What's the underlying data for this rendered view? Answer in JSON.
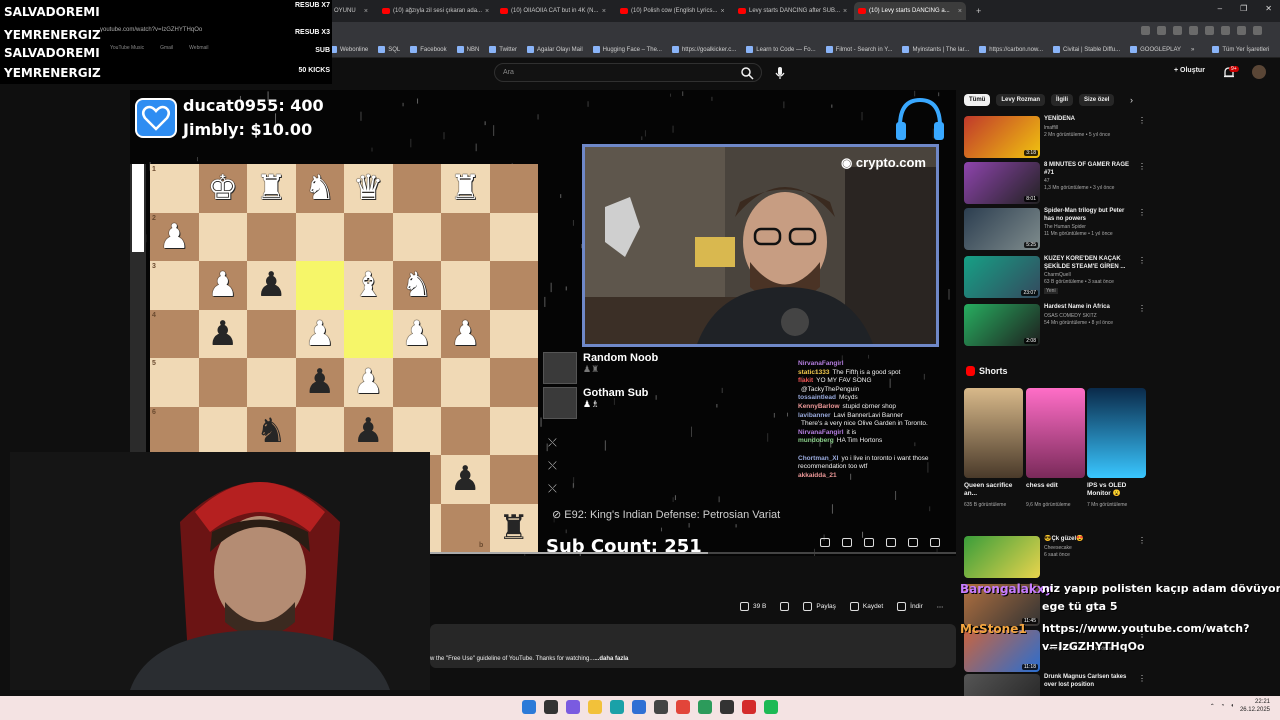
{
  "overlay": {
    "names": [
      "SALVADOREMI",
      "YEMRENERGIZ",
      "SALVADOREMI",
      "YEMRENERGIZ"
    ],
    "badges": [
      "RESUB X7",
      "RESUB X3",
      "SUB",
      "50 KICKS"
    ],
    "ghost_url": "youtube.com/watch?v=IzGZHYTHqOo",
    "ghost_items": [
      "YouTube Music",
      "Gmail",
      "Webmail"
    ]
  },
  "browser": {
    "tabs": [
      {
        "label": "OYUNU",
        "active": false
      },
      {
        "label": "(10) ağzıyla zil sesi çıkaran ada...",
        "active": false
      },
      {
        "label": "(10) OIIAOIIA CAT but in 4K (N...",
        "active": false
      },
      {
        "label": "(10) Polish cow (English Lyrics...",
        "active": false
      },
      {
        "label": "Levy starts DANCING after SUB...",
        "active": false
      },
      {
        "label": "(10) Levy starts DANCING a...",
        "active": true
      }
    ],
    "new_tab": "+",
    "bookmarks": [
      "Webonline",
      "SQL",
      "Facebook",
      "NBN",
      "Twitter",
      "Agalar Olayı Mail",
      "Hugging Face – The...",
      "https://goalkicker.c...",
      "Learn to Code — Fo...",
      "Filmot - Search in Y...",
      "Myinstants | The lar...",
      "https://carbon.now...",
      "Civitai | Stable Diffu...",
      "GOOGLEPLAY"
    ],
    "bookmarks_more": "»",
    "all_bookmarks": "Tüm Yer İşaretleri",
    "window_controls": [
      "–",
      "❐",
      "✕"
    ]
  },
  "youtube": {
    "search_placeholder": "Ara",
    "create_label": "Oluştur",
    "notifications": "9+"
  },
  "video": {
    "donations": [
      {
        "name": "ducat0955",
        "amount": "400"
      },
      {
        "name": "Jimbly",
        "amount": "$10.00"
      }
    ],
    "sponsor": "crypto.com",
    "players": [
      {
        "name": "Random Noob"
      },
      {
        "name": "Gotham Sub"
      }
    ],
    "opening": "E92: King's Indian Defense: Petrosian Variat",
    "sub_count_label": "Sub Count:",
    "sub_count": "251",
    "board_ranks": [
      "1",
      "2",
      "3",
      "4",
      "5",
      "6"
    ],
    "board_files": [
      "b"
    ],
    "chat": [
      {
        "user": "NirvanaFangirl",
        "msg": "",
        "color": "#b57ee0"
      },
      {
        "user": "static1333",
        "msg": "The Fifth is a good spot",
        "color": "#f2c94c"
      },
      {
        "user": "flakit",
        "msg": "YO MY FAV SONG",
        "color": "#e55"
      },
      {
        "user": "",
        "msg": "@TackyThePenguin",
        "color": "#e55"
      },
      {
        "user": "tossaintlead",
        "msg": "Mcyds",
        "color": "#9ad"
      },
      {
        "user": "KennyBarlow",
        "msg": "stupid corner shop",
        "color": "#e99"
      },
      {
        "user": "lavibanner",
        "msg": "Lavi BannerLavi Banner",
        "color": "#9ad"
      },
      {
        "user": "",
        "msg": "There's a very nice Olive Garden in Toronto.",
        "color": "#e55"
      },
      {
        "user": "NirvanaFangirl",
        "msg": "it is",
        "color": "#b57ee0"
      },
      {
        "user": "mundoberg",
        "msg": "HA Tim Hortons",
        "color": "#8c8"
      },
      {
        "user": "",
        "msg": "",
        "color": "#9ad"
      },
      {
        "user": "Chortman_XI",
        "msg": "yo i live in toronto i want those recommendation too wtf",
        "color": "#9ad"
      },
      {
        "user": "akkaidda_21",
        "msg": "",
        "color": "#e99"
      }
    ]
  },
  "actions": {
    "likes": "39 B",
    "share": "Paylaş",
    "save": "Kaydet",
    "download": "İndir",
    "more": "⋯"
  },
  "description": {
    "text": "w the \"Free Use\" guideline of YouTube. Thanks for watching...",
    "more": "...daha fazla"
  },
  "sidebar": {
    "chips": [
      "Tümü",
      "Levy Rozman",
      "İlgili",
      "Size özel"
    ],
    "recommendations": [
      {
        "title": "YENİDENA",
        "channel": "lmaffill",
        "meta": "2 Mn görüntüleme • 5 yıl önce",
        "duration": "3:18"
      },
      {
        "title": "8 MINUTES OF GAMER RAGE #71",
        "channel": "47",
        "meta": "1,3 Mn görüntüleme • 3 yıl önce",
        "duration": "8:01"
      },
      {
        "title": "Spider-Man trilogy but Peter has no powers",
        "channel": "The Human Spider",
        "meta": "11 Mn görüntüleme • 1 yıl önce",
        "duration": "5:25"
      },
      {
        "title": "KUZEY KORE'DEN KAÇAK ŞEKİLDE STEAM'E GİREN ...",
        "channel": "CharmQuell",
        "meta": "63 B görüntüleme • 3 saat önce",
        "duration": "23:07"
      },
      {
        "title": "Hardest Name in Africa",
        "channel": "OSAS COMEDY SKITZ",
        "meta": "54 Mn görüntüleme • 8 yıl önce",
        "duration": "2:08"
      }
    ],
    "badge_new": "Yeni",
    "shorts_title": "Shorts",
    "shorts": [
      {
        "title": "Queen sacrifice an...",
        "views": "635 B görüntüleme"
      },
      {
        "title": "chess edit",
        "views": "9,6 Mn görüntüleme"
      },
      {
        "title": "IPS vs OLED Monitor 😮",
        "views": "7 Mn görüntüleme"
      }
    ],
    "more_recs": [
      {
        "title": "😎Çk güzel😍",
        "channel": "Cheesecake",
        "meta": "6 saat önce",
        "duration": ""
      },
      {
        "title": "",
        "channel": "",
        "meta": "",
        "duration": "11:45"
      },
      {
        "title": "",
        "channel": "",
        "meta": "994 B görüntüleme • 3 yıl önce",
        "duration": "11:18"
      },
      {
        "title": "Drunk Magnus Carlsen takes over lost position",
        "channel": "",
        "meta": "",
        "duration": ""
      }
    ]
  },
  "chat_overlay": [
    {
      "name": "Barongalakxy",
      "msg": "niz yapıp polisten kaçıp adam dövüyoruz diy",
      "color": "#c77dff"
    },
    {
      "name": "",
      "msg": "ege tü gta 5",
      "color": "#fff"
    },
    {
      "name": "McStone1",
      "msg": "https://www.youtube.com/watch?",
      "color": "#f4a640"
    },
    {
      "name": "",
      "msg": "v=IzGZHYTHqOo",
      "color": "#fff"
    }
  ],
  "taskbar": {
    "time": "22:21",
    "date": "26.12.2025"
  }
}
